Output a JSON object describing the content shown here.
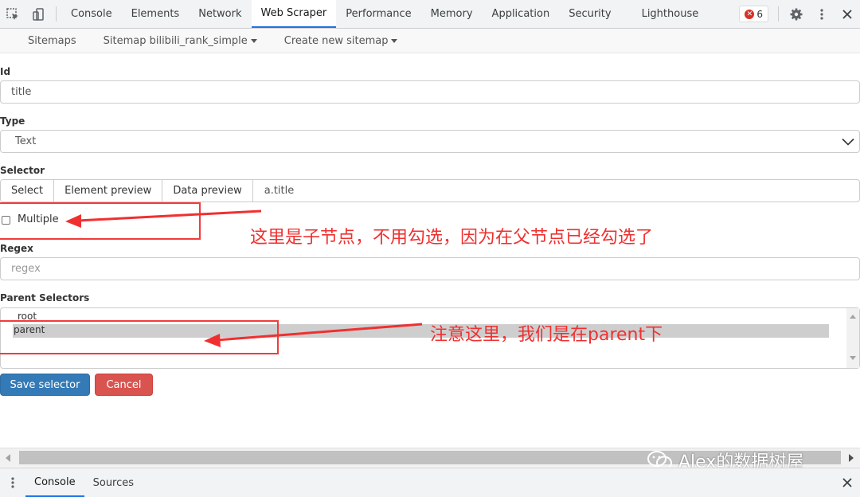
{
  "devtools": {
    "tabs": [
      "Console",
      "Elements",
      "Network",
      "Web Scraper",
      "Performance",
      "Memory",
      "Application",
      "Security",
      "Lighthouse"
    ],
    "active_tab": "Web Scraper",
    "error_count": "6",
    "accent_color": "#1a73e8"
  },
  "scraper_nav": {
    "sitemaps": "Sitemaps",
    "sitemap": "Sitemap bilibili_rank_simple",
    "create": "Create new sitemap"
  },
  "form": {
    "id_label": "Id",
    "id_value": "title",
    "type_label": "Type",
    "type_value": "Text",
    "selector_label": "Selector",
    "select_btn": "Select",
    "element_preview_btn": "Element preview",
    "data_preview_btn": "Data preview",
    "selector_value": "a.title",
    "multiple_label": "Multiple",
    "multiple_checked": false,
    "regex_label": "Regex",
    "regex_placeholder": "regex",
    "parent_label": "Parent Selectors",
    "parent_options": [
      "_root",
      "parent"
    ],
    "parent_selected": "parent",
    "save_btn": "Save selector",
    "cancel_btn": "Cancel"
  },
  "annotations": {
    "multiple_note": "这里是子节点，不用勾选，因为在父节点已经勾选了",
    "parent_note": "注意这里，我们是在parent下",
    "color": "#f03030"
  },
  "watermark": "Alex的数据树屋",
  "drawer": {
    "tabs": [
      "Console",
      "Sources"
    ],
    "active_tab": "Console"
  }
}
